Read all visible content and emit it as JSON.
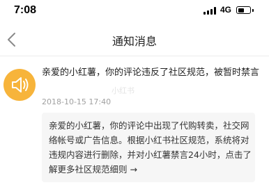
{
  "status_bar": {
    "time": "7:08",
    "network": "4G"
  },
  "nav": {
    "title": "通知消息",
    "back_icon": "chevron-left-icon"
  },
  "notification": {
    "avatar_icon": "speaker-icon",
    "avatar_color": "#f7b43b",
    "text": "亲爱的小红薯，你的评论违反了社区规范，被暂时禁言",
    "watermark": "小红书",
    "time": "2018-10-15 17:40",
    "detail": "亲爱的小红薯，你的评论中出现了代购转卖，社交网络帐号或广告信息。根据小红书社区规范，系统将对违规内容进行删除，并对小红薯禁言24小时，点击了解更多社区规范细则 →"
  }
}
